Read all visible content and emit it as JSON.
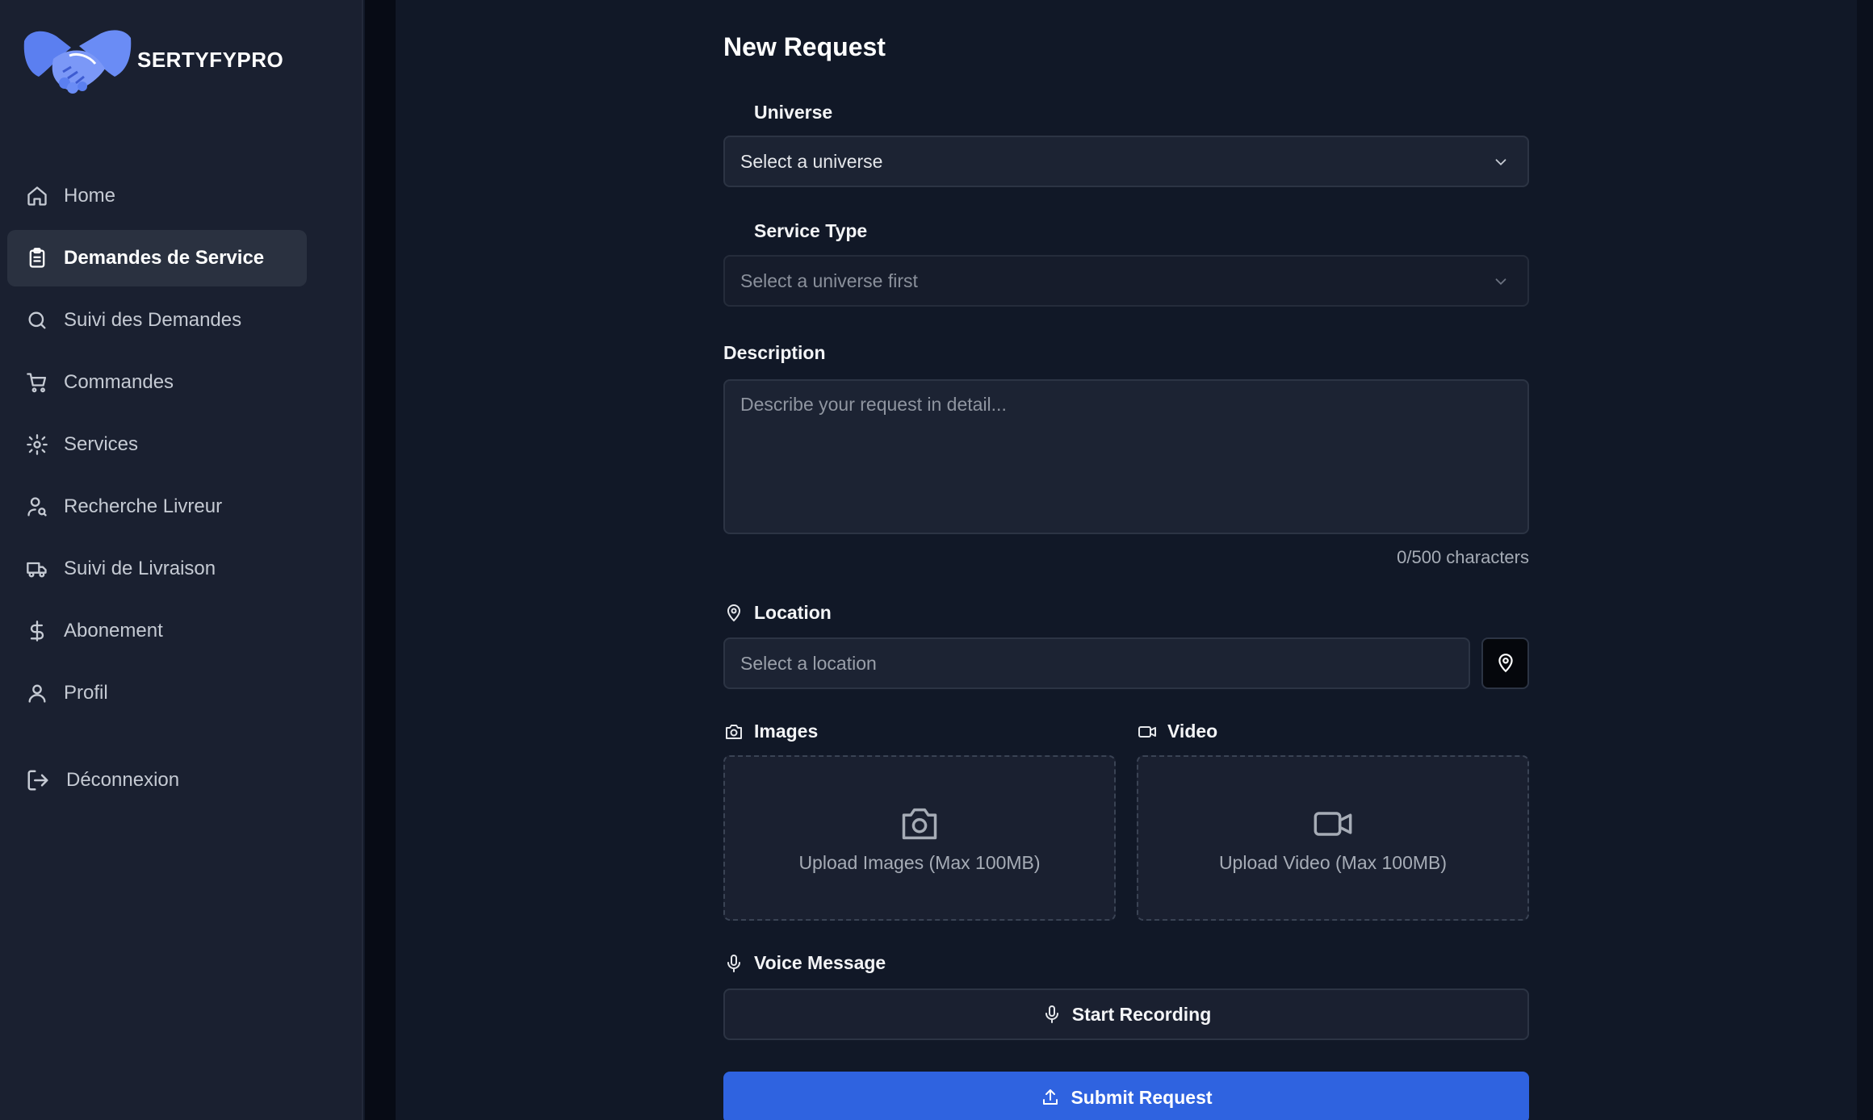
{
  "brand": {
    "name": "SERTYFYPRO"
  },
  "sidebar": {
    "items": [
      {
        "label": "Home",
        "icon": "home-icon"
      },
      {
        "label": "Demandes de Service",
        "icon": "clipboard-icon",
        "active": true
      },
      {
        "label": "Suivi des Demandes",
        "icon": "search-icon"
      },
      {
        "label": "Commandes",
        "icon": "cart-icon"
      },
      {
        "label": "Services",
        "icon": "gear-icon"
      },
      {
        "label": "Recherche Livreur",
        "icon": "user-search-icon"
      },
      {
        "label": "Suivi de Livraison",
        "icon": "truck-icon"
      },
      {
        "label": "Abonement",
        "icon": "dollar-icon"
      },
      {
        "label": "Profil",
        "icon": "user-icon"
      }
    ],
    "logout_label": "Déconnexion"
  },
  "form": {
    "title": "New Request",
    "universe": {
      "label": "Universe",
      "value": "Select a universe"
    },
    "service_type": {
      "label": "Service Type",
      "value": "Select a universe first"
    },
    "description": {
      "label": "Description",
      "placeholder": "Describe your request in detail...",
      "count": "0/500 characters"
    },
    "location": {
      "label": "Location",
      "placeholder": "Select a location"
    },
    "images": {
      "label": "Images",
      "upload_text": "Upload Images (Max 100MB)"
    },
    "video": {
      "label": "Video",
      "upload_text": "Upload Video (Max 100MB)"
    },
    "voice": {
      "label": "Voice Message",
      "button": "Start Recording"
    },
    "submit": "Submit Request"
  },
  "colors": {
    "background": "#111827",
    "sidebar": "#1a2030",
    "accent": "#2f63e0",
    "logo_blue": "#5b7ff0"
  }
}
